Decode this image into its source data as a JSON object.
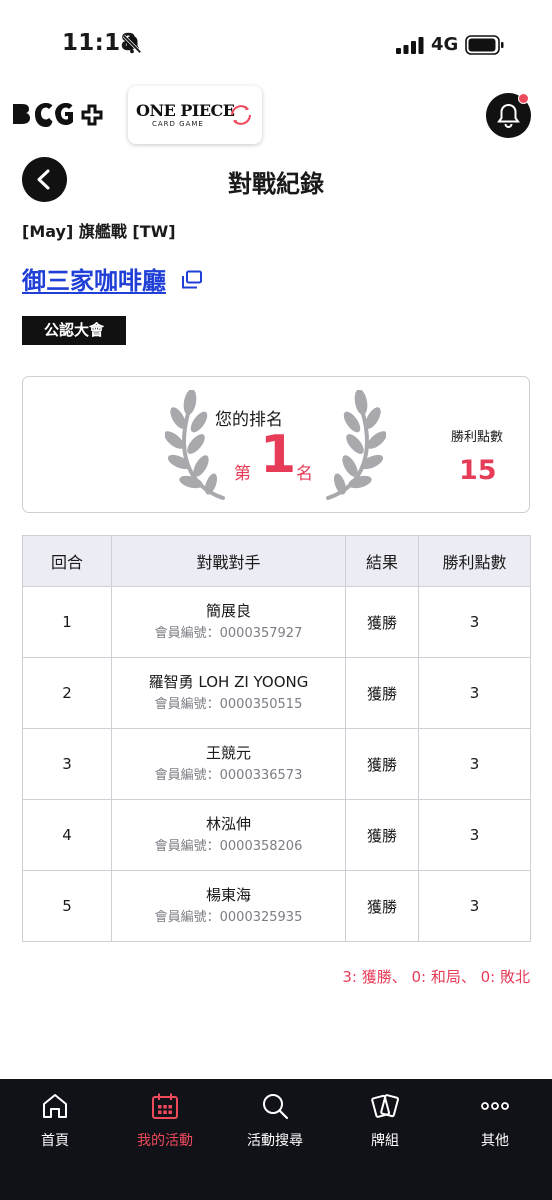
{
  "status_bar": {
    "time": "11:18",
    "network": "4G"
  },
  "header": {
    "brand_logo": "B·CG+",
    "game_logo_title": "ONE PIECE",
    "game_logo_subtitle": "CARD GAME",
    "accent_color": "#ef4a5b"
  },
  "page": {
    "title": "對戰紀錄",
    "event_name": "[May] 旗艦戰 [TW]",
    "store_name": "御三家咖啡廳",
    "badge": "公認大會"
  },
  "rank": {
    "label": "您的排名",
    "prefix": "第",
    "number": "1",
    "suffix": "名",
    "points_label": "勝利點數",
    "points": "15"
  },
  "table": {
    "headers": [
      "回合",
      "對戰對手",
      "結果",
      "勝利點數"
    ],
    "rows": [
      {
        "round": "1",
        "opponent": "簡展良",
        "member_id": "會員編號：0000357927",
        "result": "獲勝",
        "points": "3"
      },
      {
        "round": "2",
        "opponent": "羅智勇 LOH ZI YOONG",
        "member_id": "會員編號：0000350515",
        "result": "獲勝",
        "points": "3"
      },
      {
        "round": "3",
        "opponent": "王競元",
        "member_id": "會員編號：0000336573",
        "result": "獲勝",
        "points": "3"
      },
      {
        "round": "4",
        "opponent": "林泓伸",
        "member_id": "會員編號：0000358206",
        "result": "獲勝",
        "points": "3"
      },
      {
        "round": "5",
        "opponent": "楊東海",
        "member_id": "會員編號：0000325935",
        "result": "獲勝",
        "points": "3"
      }
    ]
  },
  "summary": "3: 獲勝、 0: 和局、 0: 敗北",
  "nav": {
    "items": [
      {
        "label": "首頁",
        "icon": "home-icon"
      },
      {
        "label": "我的活動",
        "icon": "calendar-icon"
      },
      {
        "label": "活動搜尋",
        "icon": "search-icon"
      },
      {
        "label": "牌組",
        "icon": "cards-icon"
      },
      {
        "label": "其他",
        "icon": "more-icon"
      }
    ]
  }
}
